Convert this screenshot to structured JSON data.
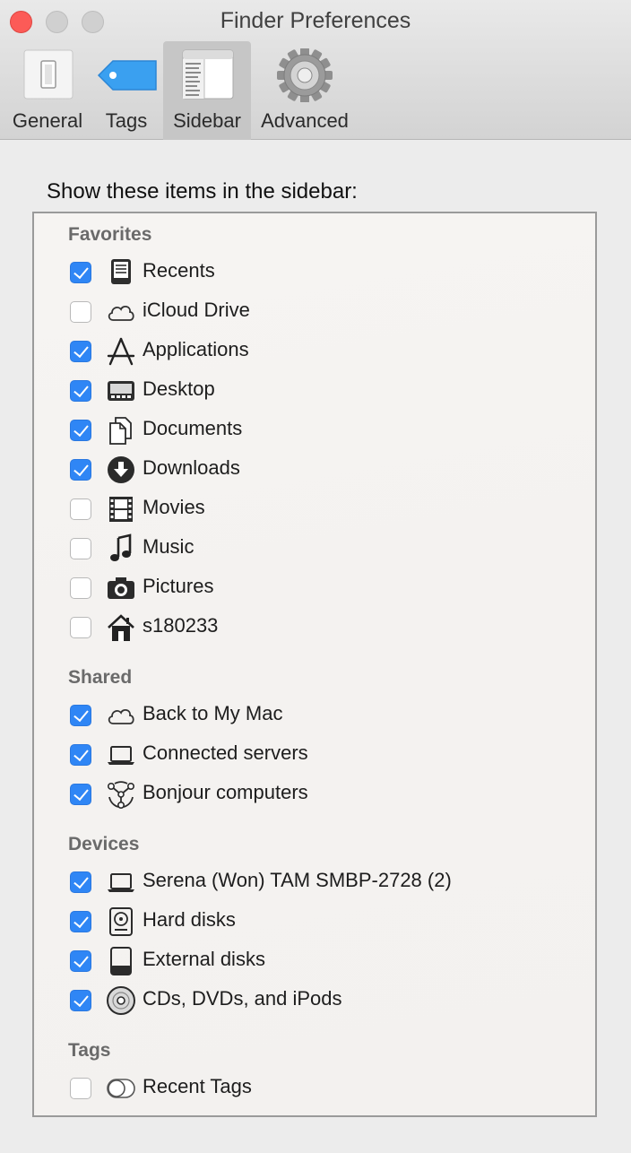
{
  "window": {
    "title": "Finder Preferences"
  },
  "toolbar": {
    "tabs": [
      {
        "label": "General",
        "icon": "general-switch-icon"
      },
      {
        "label": "Tags",
        "icon": "tag-icon"
      },
      {
        "label": "Sidebar",
        "icon": "sidebar-icon",
        "selected": true
      },
      {
        "label": "Advanced",
        "icon": "gear-icon"
      }
    ]
  },
  "panel": {
    "heading": "Show these items in the sidebar:",
    "sections": {
      "favorites": {
        "title": "Favorites",
        "items": [
          {
            "label": "Recents",
            "checked": true,
            "icon": "recents-icon"
          },
          {
            "label": "iCloud Drive",
            "checked": false,
            "icon": "cloud-icon"
          },
          {
            "label": "Applications",
            "checked": true,
            "icon": "applications-icon"
          },
          {
            "label": "Desktop",
            "checked": true,
            "icon": "desktop-icon"
          },
          {
            "label": "Documents",
            "checked": true,
            "icon": "documents-icon"
          },
          {
            "label": "Downloads",
            "checked": true,
            "icon": "downloads-icon"
          },
          {
            "label": "Movies",
            "checked": false,
            "icon": "movies-icon"
          },
          {
            "label": "Music",
            "checked": false,
            "icon": "music-note-icon"
          },
          {
            "label": "Pictures",
            "checked": false,
            "icon": "camera-icon"
          },
          {
            "label": "s180233",
            "checked": false,
            "icon": "home-icon"
          }
        ]
      },
      "shared": {
        "title": "Shared",
        "items": [
          {
            "label": "Back to My Mac",
            "checked": true,
            "icon": "cloud-icon"
          },
          {
            "label": "Connected servers",
            "checked": true,
            "icon": "laptop-icon"
          },
          {
            "label": "Bonjour computers",
            "checked": true,
            "icon": "bonjour-icon"
          }
        ]
      },
      "devices": {
        "title": "Devices",
        "items": [
          {
            "label": "Serena (Won) TAM SMBP-2728 (2)",
            "checked": true,
            "icon": "laptop-icon"
          },
          {
            "label": "Hard disks",
            "checked": true,
            "icon": "hard-disk-icon"
          },
          {
            "label": "External disks",
            "checked": true,
            "icon": "external-disk-icon"
          },
          {
            "label": "CDs, DVDs, and iPods",
            "checked": true,
            "icon": "disc-icon"
          }
        ]
      },
      "tags": {
        "title": "Tags",
        "items": [
          {
            "label": "Recent Tags",
            "checked": false,
            "icon": "tag-toggle-icon"
          }
        ]
      }
    }
  },
  "colors": {
    "accent": "#2f86f5",
    "close": "#fc5b57"
  }
}
